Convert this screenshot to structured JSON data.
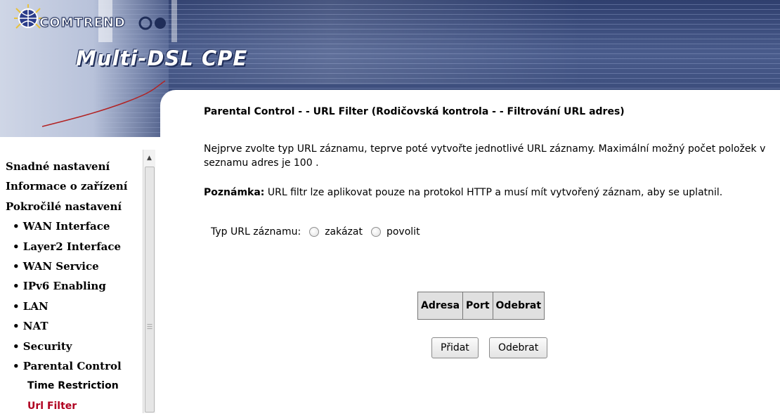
{
  "header": {
    "brand": "COMTREND",
    "product": "Multi-DSL CPE"
  },
  "sidebar": {
    "items": [
      {
        "label": "Snadné nastavení",
        "level": 0
      },
      {
        "label": "Informace o zařízení",
        "level": 0
      },
      {
        "label": "Pokročilé nastavení",
        "level": 0
      },
      {
        "label": "• WAN Interface",
        "level": 1
      },
      {
        "label": "• Layer2 Interface",
        "level": 1
      },
      {
        "label": "• WAN Service",
        "level": 1
      },
      {
        "label": "• IPv6 Enabling",
        "level": 1
      },
      {
        "label": "• LAN",
        "level": 1
      },
      {
        "label": "• NAT",
        "level": 1
      },
      {
        "label": "• Security",
        "level": 1
      },
      {
        "label": "• Parental Control",
        "level": 1
      },
      {
        "label": "Time Restriction",
        "level": 2
      },
      {
        "label": "Url Filter",
        "level": 2,
        "active": true
      }
    ]
  },
  "main": {
    "title": "Parental Control - - URL Filter (Rodičovská kontrola - - Filtrování URL adres)",
    "description": "Nejprve zvolte typ URL záznamu, teprve poté vytvořte jednotlivé URL záznamy. Maximální možný počet položek v seznamu adres je 100 .",
    "note_label": "Poznámka:",
    "note_text": " URL filtr lze aplikovat pouze na protokol HTTP a musí mít vytvořený záznam, aby se uplatnil.",
    "type_label": "Typ URL záznamu:",
    "option_block": "zakázat",
    "option_allow": "povolit",
    "table_headers": [
      "Adresa",
      "Port",
      "Odebrat"
    ],
    "add_button": "Přidat",
    "remove_button": "Odebrat"
  },
  "colors": {
    "active_menu": "#b00020",
    "banner": "#3a4a78"
  }
}
